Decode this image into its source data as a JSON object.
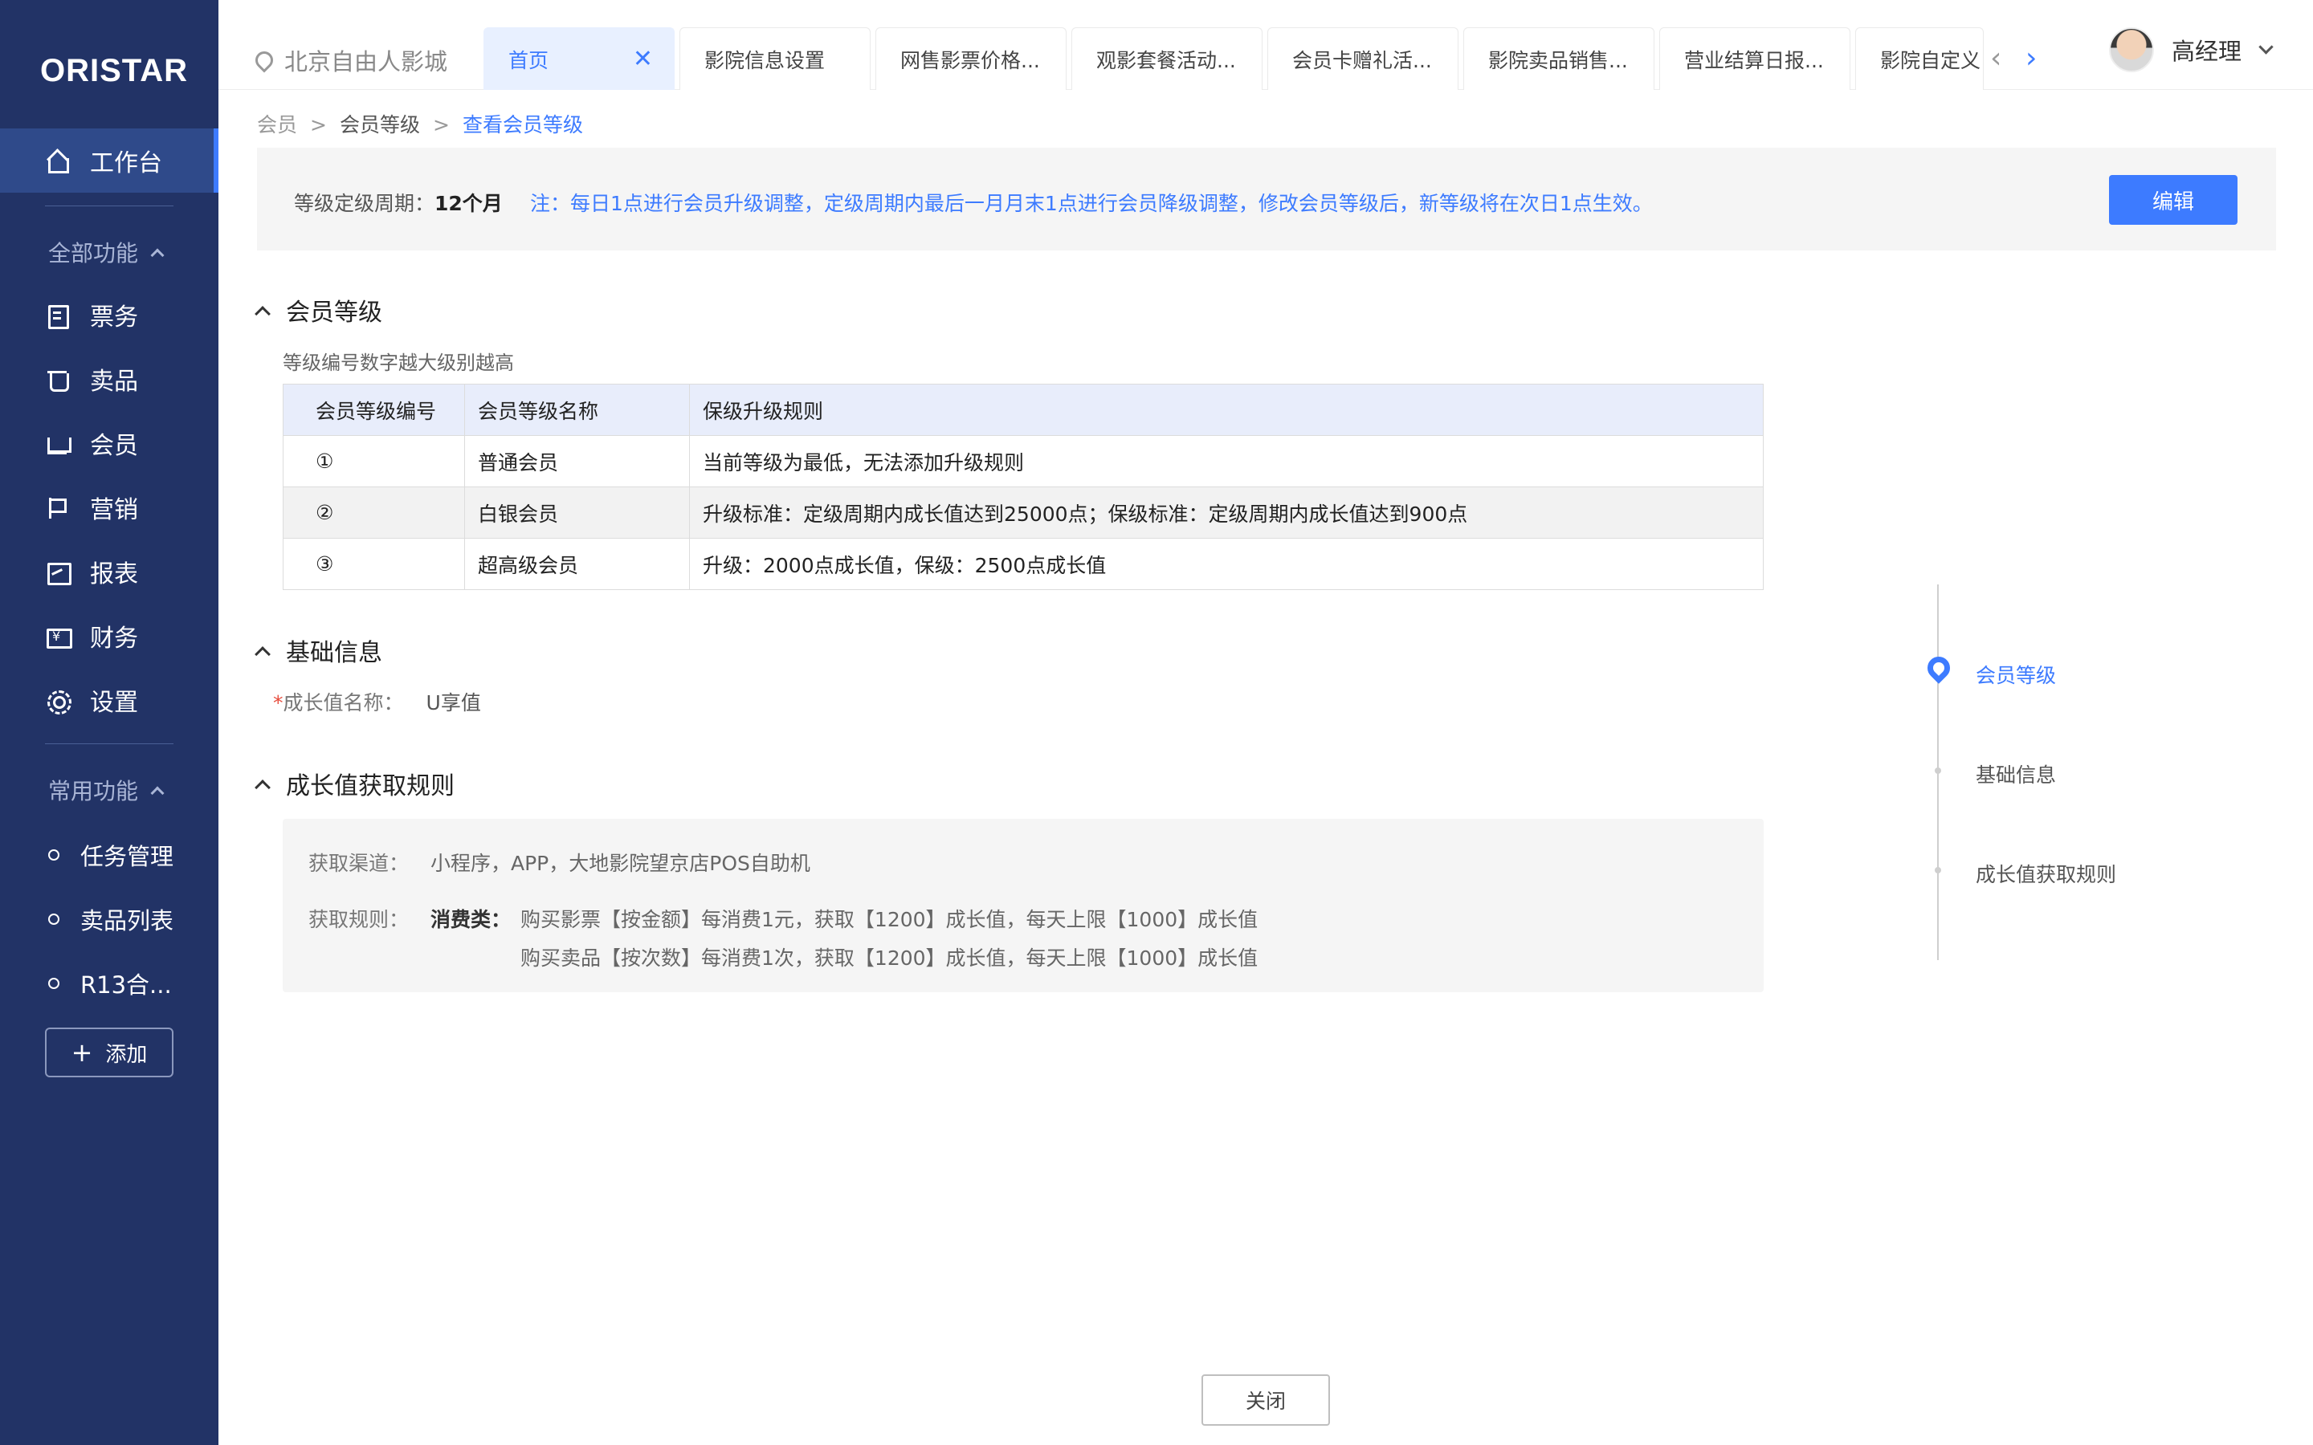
{
  "brand": {
    "logo_text": "ORISTAR"
  },
  "sidebar": {
    "workbench": "工作台",
    "all_functions_title": "全部功能",
    "items": [
      {
        "label": "票务",
        "icon": "ticket-icon"
      },
      {
        "label": "卖品",
        "icon": "cup-icon"
      },
      {
        "label": "会员",
        "icon": "crown-icon"
      },
      {
        "label": "营销",
        "icon": "flag-icon"
      },
      {
        "label": "报表",
        "icon": "chart-icon"
      },
      {
        "label": "财务",
        "icon": "finance-icon"
      },
      {
        "label": "设置",
        "icon": "gear-icon"
      }
    ],
    "common_title": "常用功能",
    "favorites": [
      "任务管理",
      "卖品列表",
      "R13合..."
    ],
    "add_label": "添加"
  },
  "topbar": {
    "location": "北京自由人影城",
    "tabs": [
      "首页",
      "影院信息设置",
      "网售影票价格...",
      "观影套餐活动...",
      "会员卡赠礼活...",
      "影院卖品销售...",
      "营业结算日报...",
      "影院自定义"
    ],
    "user_name": "高经理"
  },
  "breadcrumb": {
    "root": "会员",
    "mid": "会员等级",
    "current": "查看会员等级"
  },
  "banner": {
    "period_label": "等级定级周期：",
    "period_value": "12个月",
    "note": "注：每日1点进行会员升级调整，定级周期内最后一月月末1点进行会员降级调整，修改会员等级后，新等级将在次日1点生效。",
    "edit_label": "编辑"
  },
  "level_section": {
    "title": "会员等级",
    "hint": "等级编号数字越大级别越高",
    "headers": [
      "会员等级编号",
      "会员等级名称",
      "保级升级规则"
    ],
    "rows": [
      {
        "no": "①",
        "name": "普通会员",
        "rule": "当前等级为最低，无法添加升级规则"
      },
      {
        "no": "②",
        "name": "白银会员",
        "rule": "升级标准：定级周期内成长值达到25000点；保级标准：定级周期内成长值达到900点"
      },
      {
        "no": "③",
        "name": "超高级会员",
        "rule": "升级：2000点成长值，保级：2500点成长值"
      }
    ]
  },
  "basic_section": {
    "title": "基础信息",
    "required_mark": "*",
    "field_label": "成长值名称：",
    "field_value": "U享值"
  },
  "growth_section": {
    "title": "成长值获取规则",
    "channel_label": "获取渠道：",
    "channel_value": "小程序，APP，大地影院望京店POS自助机",
    "rule_label": "获取规则：",
    "rule_category": "消费类：",
    "rule_lines": [
      "购买影票【按金额】每消费1元，获取【1200】成长值，每天上限【1000】成长值",
      "购买卖品【按次数】每消费1次，获取【1200】成长值，每天上限【1000】成长值"
    ]
  },
  "anchor_nav": {
    "items": [
      "会员等级",
      "基础信息",
      "成长值获取规则"
    ],
    "active": 0
  },
  "footer": {
    "close_label": "关闭"
  },
  "colors": {
    "sidebar_bg": "#223366",
    "accent": "#3d7bff",
    "header_bg": "#e8edfb"
  }
}
